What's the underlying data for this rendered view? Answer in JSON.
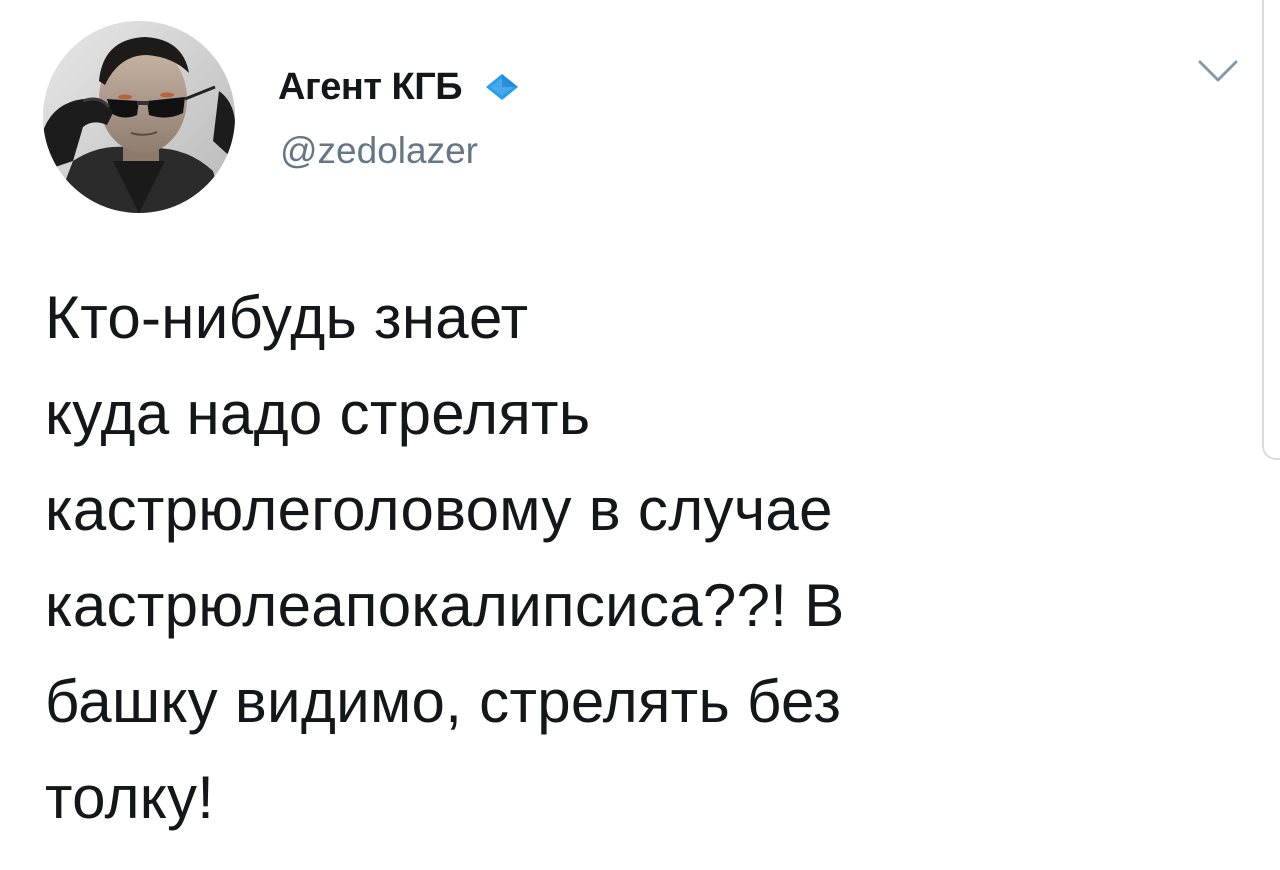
{
  "author": {
    "display_name": "Агент КГБ",
    "handle": "@zedolazer",
    "verified": true,
    "avatar_icon": "man-with-sunglasses-avatar"
  },
  "menu": {
    "icon": "chevron-down-icon"
  },
  "tweet": {
    "text": "Кто-нибудь знает\nкуда надо стрелять\nкастрюлеголовому в случае\nкастрюлеапокалипсиса??! В\nбашку видимо, стрелять без\nтолку!"
  },
  "colors": {
    "text": "#14171a",
    "secondary": "#657786",
    "verified_badge": "#1da1f2",
    "background": "#ffffff"
  }
}
